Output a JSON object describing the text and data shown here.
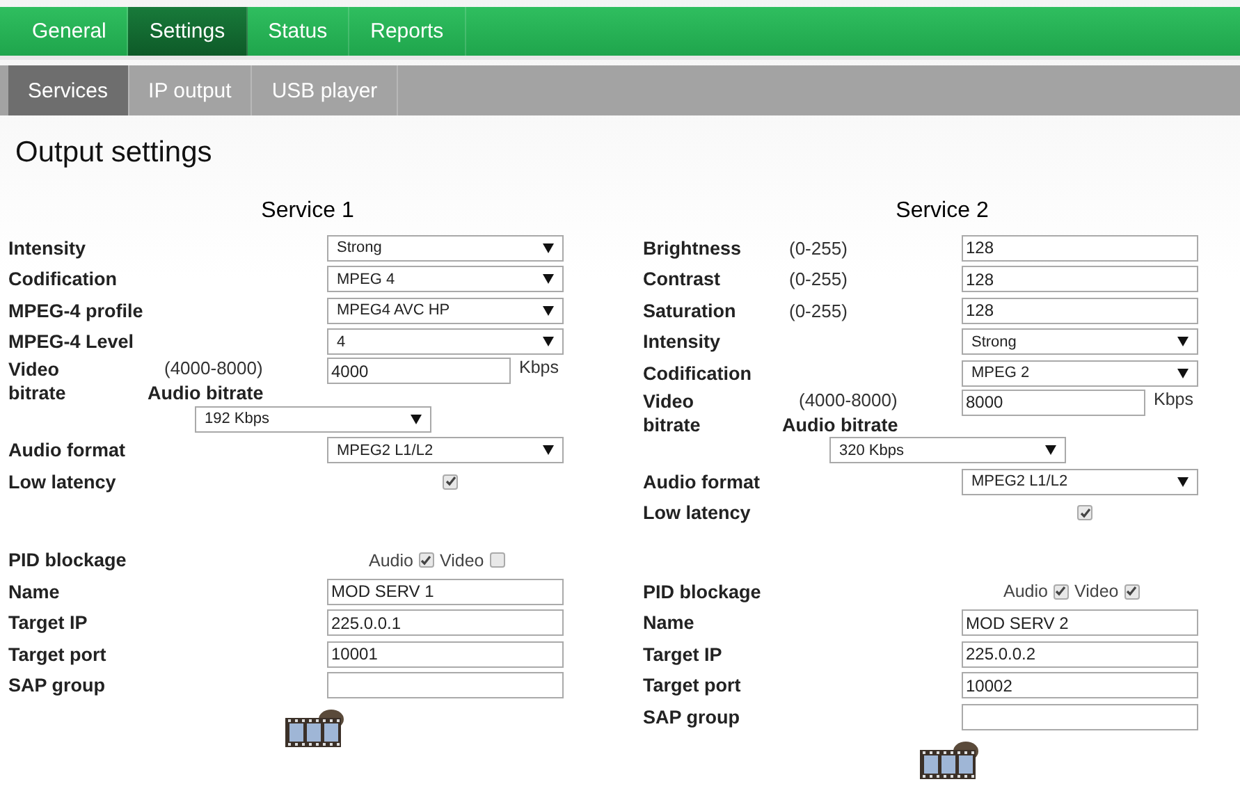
{
  "main_tabs": [
    {
      "label": "General",
      "selected": false
    },
    {
      "label": "Settings",
      "selected": true
    },
    {
      "label": "Status",
      "selected": false
    },
    {
      "label": "Reports",
      "selected": false
    }
  ],
  "sub_tabs": [
    {
      "label": "Services",
      "selected": true
    },
    {
      "label": "IP output",
      "selected": false
    },
    {
      "label": "USB player",
      "selected": false
    }
  ],
  "title": "Output settings",
  "services": [
    {
      "title": "Service 1",
      "rows": [
        {
          "kind": "select",
          "label": "Intensity",
          "value": "Strong"
        },
        {
          "kind": "select",
          "label": "Codification",
          "value": "MPEG 4"
        },
        {
          "kind": "select",
          "label": "MPEG-4 profile",
          "value": "MPEG4 AVC HP"
        },
        {
          "kind": "select",
          "label": "MPEG-4 Level",
          "value": "4"
        },
        {
          "kind": "bitrate",
          "label": "Video bitrate",
          "hint": "(4000-8000)",
          "value": "4000",
          "unit": "Kbps"
        },
        {
          "kind": "audio",
          "label": "Audio bitrate",
          "value": "192 Kbps"
        },
        {
          "kind": "select",
          "label": "Audio format",
          "value": "MPEG2 L1/L2"
        },
        {
          "kind": "check",
          "label": "Low latency",
          "checked": true
        },
        {
          "kind": "pid",
          "label": "PID blockage",
          "options": [
            {
              "label": "Audio",
              "checked": true
            },
            {
              "label": "Video",
              "checked": false
            }
          ]
        },
        {
          "kind": "text",
          "label": "Name",
          "value": "MOD SERV 1"
        },
        {
          "kind": "text",
          "label": "Target IP",
          "value": "225.0.0.1"
        },
        {
          "kind": "text",
          "label": "Target port",
          "value": "10001"
        },
        {
          "kind": "text",
          "label": "SAP group",
          "value": ""
        }
      ]
    },
    {
      "title": "Service 2",
      "rows": [
        {
          "kind": "text",
          "label": "Brightness",
          "hint": "(0-255)",
          "value": "128"
        },
        {
          "kind": "text",
          "label": "Contrast",
          "hint": "(0-255)",
          "value": "128"
        },
        {
          "kind": "text",
          "label": "Saturation",
          "hint": "(0-255)",
          "value": "128"
        },
        {
          "kind": "select",
          "label": "Intensity",
          "value": "Strong"
        },
        {
          "kind": "select",
          "label": "Codification",
          "value": "MPEG 2"
        },
        {
          "kind": "bitrate",
          "label": "Video bitrate",
          "hint": "(4000-8000)",
          "value": "8000",
          "unit": "Kbps"
        },
        {
          "kind": "audio",
          "label": "Audio bitrate",
          "value": "320 Kbps"
        },
        {
          "kind": "select",
          "label": "Audio format",
          "value": "MPEG2 L1/L2"
        },
        {
          "kind": "check",
          "label": "Low latency",
          "checked": true
        },
        {
          "kind": "pid",
          "label": "PID blockage",
          "options": [
            {
              "label": "Audio",
              "checked": true
            },
            {
              "label": "Video",
              "checked": true
            }
          ]
        },
        {
          "kind": "text",
          "label": "Name",
          "value": "MOD SERV 2"
        },
        {
          "kind": "text",
          "label": "Target IP",
          "value": "225.0.0.2"
        },
        {
          "kind": "text",
          "label": "Target port",
          "value": "10002"
        },
        {
          "kind": "text",
          "label": "SAP group",
          "value": ""
        }
      ]
    }
  ]
}
